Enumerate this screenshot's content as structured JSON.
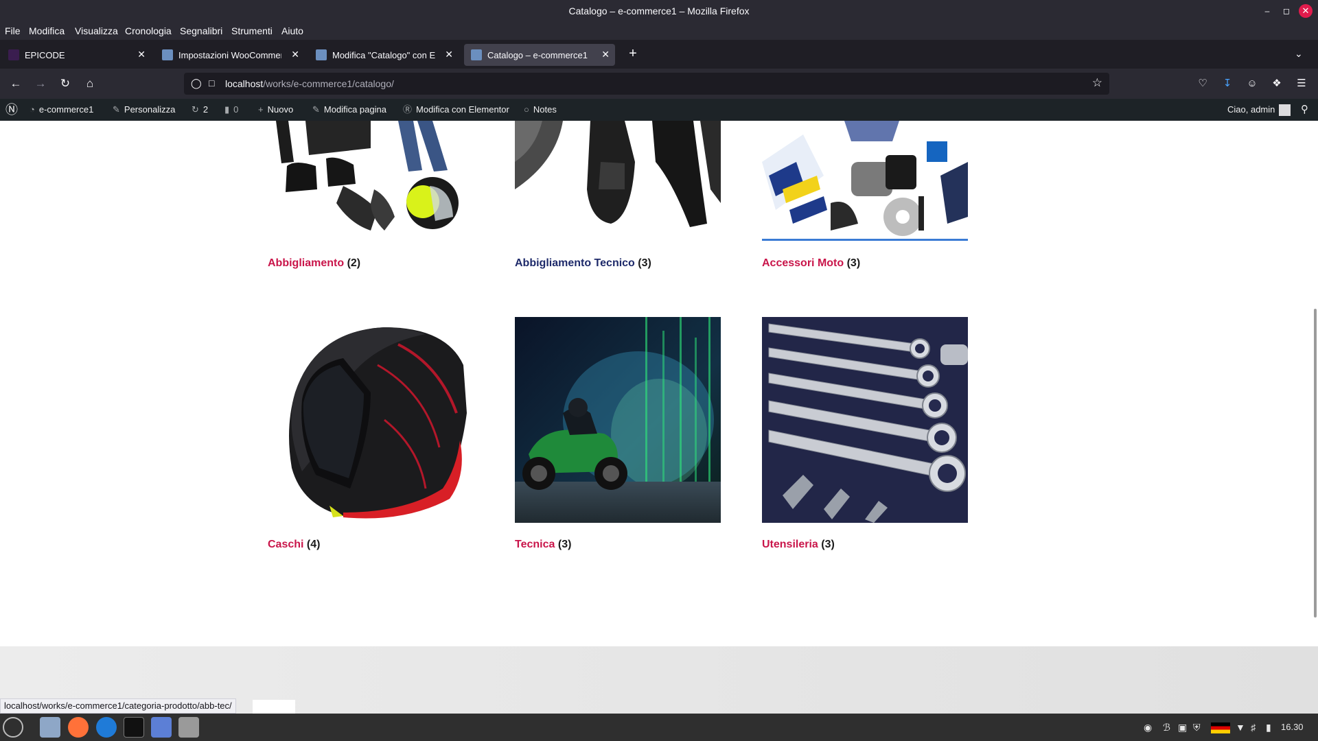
{
  "window": {
    "title": "Catalogo – e-commerce1 – Mozilla Firefox"
  },
  "menu": [
    "File",
    "Modifica",
    "Visualizza",
    "Cronologia",
    "Segnalibri",
    "Strumenti",
    "Aiuto"
  ],
  "tabs": [
    {
      "label": "EPICODE"
    },
    {
      "label": "Impostazioni WooCommerce"
    },
    {
      "label": "Modifica \"Catalogo\" con Elementor"
    },
    {
      "label": "Catalogo – e-commerce1"
    }
  ],
  "address": {
    "host": "localhost",
    "path": "/works/e-commerce1/catalogo/"
  },
  "wp_admin_bar": {
    "site": "e-commerce1",
    "customize": "Personalizza",
    "updates": "2",
    "comments": "0",
    "new": "Nuovo",
    "edit_page": "Modifica pagina",
    "elementor": "Modifica con Elementor",
    "notes": "Notes",
    "greeting": "Ciao, admin"
  },
  "categories": [
    {
      "name": "Abbigliamento",
      "count": "(2)"
    },
    {
      "name": "Abbigliamento Tecnico",
      "count": "(3)"
    },
    {
      "name": "Accessori Moto",
      "count": "(3)"
    },
    {
      "name": "Caschi",
      "count": "(4)"
    },
    {
      "name": "Tecnica",
      "count": "(3)"
    },
    {
      "name": "Utensileria",
      "count": "(3)"
    }
  ],
  "status_link": "localhost/works/e-commerce1/categoria-prodotto/abb-tec/",
  "taskbar": {
    "clock": "16.30"
  },
  "colors": {
    "link": "#c9154a",
    "visited_link": "#1e2a6a",
    "wp_bar": "#1d2327"
  }
}
